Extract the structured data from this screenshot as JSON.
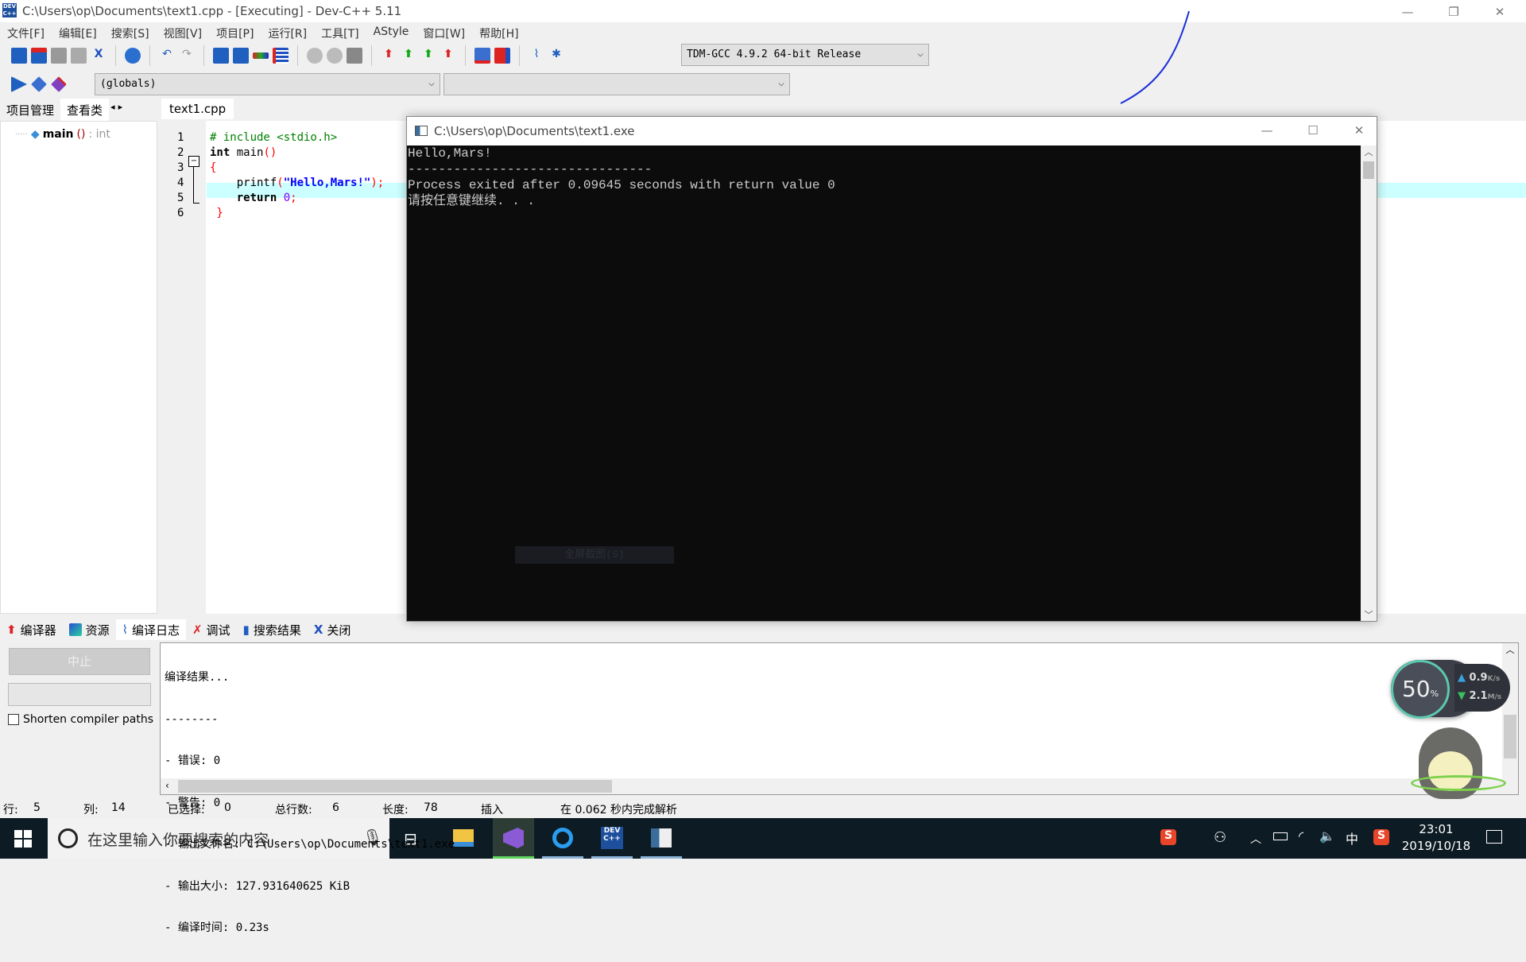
{
  "window": {
    "title": "C:\\Users\\op\\Documents\\text1.cpp - [Executing] - Dev-C++ 5.11",
    "app_icon": "DEV"
  },
  "menu": [
    "文件[F]",
    "编辑[E]",
    "搜索[S]",
    "视图[V]",
    "项目[P]",
    "运行[R]",
    "工具[T]",
    "AStyle",
    "窗口[W]",
    "帮助[H]"
  ],
  "toolbar": {
    "compiler_select": "TDM-GCC 4.9.2 64-bit Release",
    "scope_select": "(globals)",
    "member_select": ""
  },
  "left_panel": {
    "tabs": [
      "项目管理",
      "查看类"
    ],
    "tree": {
      "name": "main",
      "parens": "()",
      "type": ": int"
    }
  },
  "editor": {
    "tab": "text1.cpp",
    "lines": [
      {
        "n": "1",
        "parts": [
          {
            "t": "# include <stdio.h>",
            "c": "#008000"
          }
        ]
      },
      {
        "n": "2",
        "parts": [
          {
            "t": "int ",
            "c": "#000",
            "b": true
          },
          {
            "t": "main",
            "c": "#000"
          },
          {
            "t": "()",
            "c": "#ff0000"
          }
        ]
      },
      {
        "n": "3",
        "parts": [
          {
            "t": "{",
            "c": "#ff0000"
          }
        ]
      },
      {
        "n": "4",
        "parts": [
          {
            "t": "    printf",
            "c": "#000"
          },
          {
            "t": "(",
            "c": "#ff0000"
          },
          {
            "t": "\"Hello,Mars!\"",
            "c": "#0000ff",
            "b": true
          },
          {
            "t": ");",
            "c": "#ff0000"
          }
        ]
      },
      {
        "n": "5",
        "parts": [
          {
            "t": "    return ",
            "c": "#000",
            "b": true
          },
          {
            "t": "0",
            "c": "#8000ff"
          },
          {
            "t": ";",
            "c": "#ff0000"
          }
        ]
      },
      {
        "n": "6",
        "parts": [
          {
            "t": " }",
            "c": "#ff0000"
          }
        ]
      }
    ],
    "highlight_line": 5,
    "highlight_color": "#ccffff"
  },
  "console": {
    "title": "C:\\Users\\op\\Documents\\text1.exe",
    "lines": [
      "Hello,Mars!",
      "--------------------------------",
      "Process exited after 0.09645 seconds with return value 0",
      "请按任意键继续. . ."
    ],
    "overlay_button": "全屏截图(S)"
  },
  "bottom_tabs": [
    "编译器",
    "资源",
    "编译日志",
    "调试",
    "搜索结果",
    "关闭"
  ],
  "bottom_left": {
    "abort_button": "中止",
    "shorten_label": "Shorten compiler paths",
    "shorten_checked": false
  },
  "compile_log": [
    "编译结果...",
    "--------",
    "- 错误: 0",
    "- 警告: 0",
    "- 输出文件名: C:\\Users\\op\\Documents\\text1.exe",
    "- 输出大小: 127.931640625 KiB",
    "- 编译时间: 0.23s"
  ],
  "status": {
    "row_label": "行:",
    "row": "5",
    "col_label": "列:",
    "col": "14",
    "sel_label": "已选择:",
    "sel": "0",
    "total_label": "总行数:",
    "total": "6",
    "len_label": "长度:",
    "len": "78",
    "mode": "插入",
    "parse": "在 0.062 秒内完成解析"
  },
  "widget": {
    "cpu": "50",
    "cpu_unit": "%",
    "up": "0.9",
    "up_unit": "K/s",
    "down": "2.1",
    "down_unit": "M/s"
  },
  "taskbar": {
    "search_placeholder": "在这里输入你要搜索的内容",
    "time": "23:01",
    "date": "2019/10/18",
    "ime": "中"
  }
}
